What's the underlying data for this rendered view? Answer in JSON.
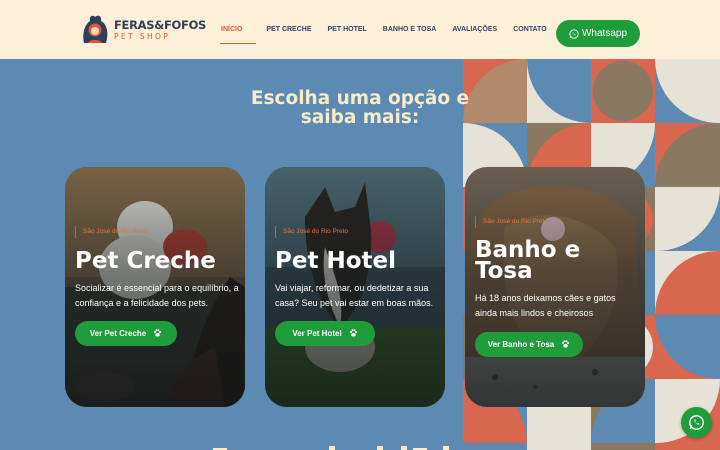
{
  "brand": {
    "name": "FERAS&FOFOS",
    "tagline": "PET SHOP",
    "colors": {
      "header_bg": "#fdf0d8",
      "primary_blue": "#5c8ab3",
      "accent_orange": "#e0563a",
      "green": "#1f9d3a",
      "cream": "#f8ebc8"
    }
  },
  "nav": {
    "items": [
      {
        "label": "INÍCIO",
        "active": true
      },
      {
        "label": "PET CRECHE",
        "active": false
      },
      {
        "label": "PET HOTEL",
        "active": false
      },
      {
        "label": "BANHO E TOSA",
        "active": false
      },
      {
        "label": "AVALIAÇÕES",
        "active": false
      },
      {
        "label": "CONTATO",
        "active": false
      }
    ],
    "whatsapp_label": "Whatsapp",
    "whatsapp_icon": "whatsapp-icon"
  },
  "hero": {
    "heading_line1": "Escolha uma opção e",
    "heading_line2": "saiba mais:"
  },
  "cards": [
    {
      "location": "São José do Rio Preto",
      "title": "Pet Creche",
      "description": "Socializar é essencial para o equilíbrio, a confiança e a felicidade dos pets.",
      "button": "Ver Pet Creche",
      "button_icon": "paw-icon"
    },
    {
      "location": "São José do Rio Preto",
      "title": "Pet Hotel",
      "description": "Vai viajar, reformar, ou dedetizar a sua casa? Seu pet vai estar em boas mãos.",
      "button": "Ver Pet Hotel",
      "button_icon": "paw-icon"
    },
    {
      "location": "São José do Rio Preto",
      "title_line1": "Banho e",
      "title_line2": "Tosa",
      "description": "Há 18 anos deixamos cães e gatos ainda mais lindos e cheirosos",
      "button": "Ver Banho e Tosa",
      "button_icon": "paw-icon"
    }
  ],
  "floating_button_icon": "whatsapp-icon"
}
